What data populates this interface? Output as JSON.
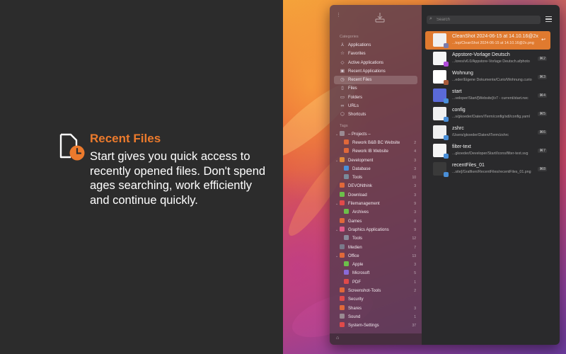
{
  "promo": {
    "title": "Recent Files",
    "body": "Start gives you quick access to recently opened files. Don't spend ages searching, work efficiently and continue quickly.",
    "accent_color": "#ec7a2c",
    "icon": "recent-file-clock-icon"
  },
  "sidebar": {
    "categories_header": "Categories",
    "categories": [
      {
        "label": "Applications",
        "icon": "apps-icon"
      },
      {
        "label": "Favorites",
        "icon": "star-icon"
      },
      {
        "label": "Active Applications",
        "icon": "active-apps-icon"
      },
      {
        "label": "Recent Applications",
        "icon": "recent-apps-icon"
      },
      {
        "label": "Recent Files",
        "icon": "recent-files-icon",
        "selected": true
      },
      {
        "label": "Files",
        "icon": "file-icon"
      },
      {
        "label": "Folders",
        "icon": "folder-icon"
      },
      {
        "label": "URLs",
        "icon": "link-icon"
      },
      {
        "label": "Shortcuts",
        "icon": "shortcuts-icon"
      }
    ],
    "tags_header": "Tags",
    "tags": [
      {
        "label": "– Projects –",
        "count": "",
        "color": "#9a8a92",
        "level": 0,
        "chevron": "⌄"
      },
      {
        "label": "Rework B&B BC Website",
        "count": "2",
        "color": "#e0683a",
        "level": 1
      },
      {
        "label": "Rework IB Website",
        "count": "4",
        "color": "#e0683a",
        "level": 1
      },
      {
        "label": "Development",
        "count": "3",
        "color": "#e08a3a",
        "level": 0,
        "chevron": "⌄"
      },
      {
        "label": "Database",
        "count": "3",
        "color": "#4a8fd8",
        "level": 1
      },
      {
        "label": "Tools",
        "count": "10",
        "color": "#7a8a9a",
        "level": 1
      },
      {
        "label": "DEVONthink",
        "count": "3",
        "color": "#e0683a",
        "level": 0
      },
      {
        "label": "Download",
        "count": "3",
        "color": "#6cbf4a",
        "level": 0
      },
      {
        "label": "Filemanagement",
        "count": "9",
        "color": "#e04a4a",
        "level": 0,
        "chevron": "⌄"
      },
      {
        "label": "Archives",
        "count": "3",
        "color": "#6cbf4a",
        "level": 1
      },
      {
        "label": "Games",
        "count": "8",
        "color": "#e0683a",
        "level": 0
      },
      {
        "label": "Graphics Applications",
        "count": "9",
        "color": "#e05a8a",
        "level": 0,
        "chevron": "⌄"
      },
      {
        "label": "Tools",
        "count": "12",
        "color": "#8a8a9a",
        "level": 1
      },
      {
        "label": "Medien",
        "count": "7",
        "color": "#7a7a8a",
        "level": 0
      },
      {
        "label": "Office",
        "count": "13",
        "color": "#e0683a",
        "level": 0,
        "chevron": "⌄"
      },
      {
        "label": "Apple",
        "count": "3",
        "color": "#6cbf4a",
        "level": 1
      },
      {
        "label": "Microsoft",
        "count": "5",
        "color": "#8a6ad8",
        "level": 1
      },
      {
        "label": "PDF",
        "count": "1",
        "color": "#e04a4a",
        "level": 1
      },
      {
        "label": "Screenshot-Tools",
        "count": "2",
        "color": "#e0683a",
        "level": 0
      },
      {
        "label": "Security",
        "count": "",
        "color": "#e04a4a",
        "level": 0
      },
      {
        "label": "Shares",
        "count": "3",
        "color": "#e0683a",
        "level": 0
      },
      {
        "label": "Sound",
        "count": "1",
        "color": "#9a8a92",
        "level": 0
      },
      {
        "label": "System-Settings",
        "count": "37",
        "color": "#e04a4a",
        "level": 0
      }
    ]
  },
  "search": {
    "placeholder": "Search"
  },
  "files": [
    {
      "title": "CleanShot 2024-06-15 at 14.10.16@2x",
      "path": "...top/CleanShot 2024-06-15 at 14.10.16@2x.png",
      "key": "↩",
      "selected": true,
      "thumb_color": "#f0f0f0",
      "badge_color": "#7a7aa8"
    },
    {
      "title": "Appstore-Vorlage Deutsch",
      "path": "...lores/v6.0/Appstore-Vorlage Deutsch.afphoto",
      "key": "⌘2",
      "thumb_color": "#f5f5f5",
      "badge_color": "#b04ad8"
    },
    {
      "title": "Wohnung",
      "path": "...eder/Eigene Dokumente/Curio/Wohnung.curio",
      "key": "⌘3",
      "thumb_color": "#ffffff",
      "badge_color": "#a85a3a"
    },
    {
      "title": "start",
      "path": "...veloper/Start/[Website]/v7 - current/start.rwc",
      "key": "⌘4",
      "thumb_color": "#5a6ad8",
      "badge_color": "#4a8fd8"
    },
    {
      "title": "config",
      "path": "...s/gkoeder/Daten/iTerm/config/sdl/config.yaml",
      "key": "⌘5",
      "thumb_color": "#f0f0f0",
      "badge_color": "#4a8fd8"
    },
    {
      "title": "zshrc",
      "path": "/Users/gkoeder/Daten/iTerm/zshrc",
      "key": "⌘6",
      "thumb_color": "#f0f0f0",
      "badge_color": "#4a8fd8"
    },
    {
      "title": "filter-text",
      "path": "...gkoeder/Developer/Start/Icons/filter-text.svg",
      "key": "⌘7",
      "thumb_color": "#f5f5f5",
      "badge_color": "#4a8fd8"
    },
    {
      "title": "recentFiles_01",
      "path": "...site]/Grafiken/RecentFiles/recentFiles_01.png",
      "key": "⌘8",
      "thumb_color": "#3a3a3a",
      "badge_color": "#4a8fd8"
    }
  ]
}
